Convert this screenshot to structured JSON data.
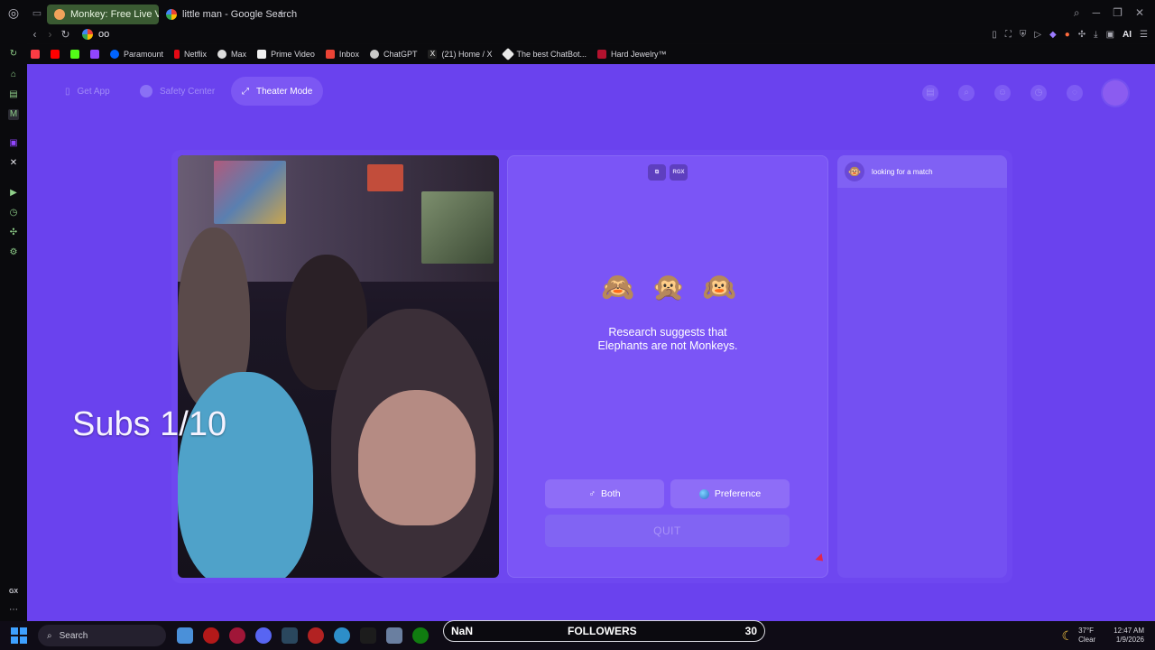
{
  "browser": {
    "tabs": [
      {
        "title": "Monkey: Free Live Vid",
        "active": true
      },
      {
        "title": "little man - Google Search",
        "active": false
      }
    ],
    "address": "oo",
    "bookmarks": [
      "Paramount",
      "Netflix",
      "Max",
      "Prime Video",
      "Inbox",
      "ChatGPT",
      "(21) Home / X",
      "The best ChatBot...",
      "Hard Jewelry™"
    ],
    "ai_label": "AI",
    "gx_label": "GX"
  },
  "page": {
    "top_nav": {
      "get_app": "Get App",
      "safety_center": "Safety Center",
      "theater_mode": "Theater Mode"
    },
    "overlay_text": "Subs 1/10",
    "match": {
      "monkeys": [
        "🙈",
        "🙊",
        "🙉"
      ],
      "research_line1": "Research suggests that",
      "research_line2": "Elephants are not Monkeys.",
      "both_label": "Both",
      "preference_label": "Preference",
      "quit_label": "QUIT",
      "rgx_label": "RGX"
    },
    "chat": {
      "status": "looking for a match"
    }
  },
  "taskbar": {
    "search_placeholder": "Search",
    "followers_left": "NaN",
    "followers_label": "FOLLOWERS",
    "followers_count": "30",
    "weather_temp": "37°F",
    "weather_cond": "Clear",
    "time": "12:47 AM",
    "date": "1/9/2026"
  },
  "colors": {
    "page_bg": "#6a42ee",
    "panel": "#7b55f6",
    "active_tab": "#3a5a32"
  }
}
